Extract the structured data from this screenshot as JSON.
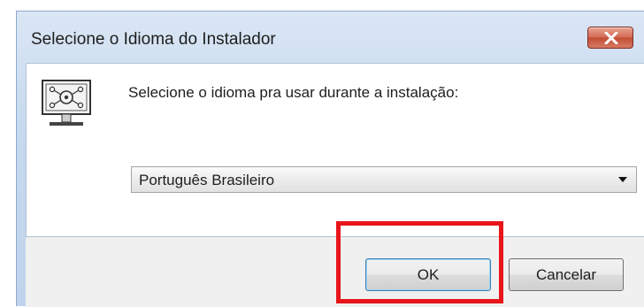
{
  "window": {
    "title": "Selecione o Idioma do Instalador"
  },
  "content": {
    "prompt": "Selecione o idioma pra usar durante a instalação:",
    "language_select": {
      "selected": "Português Brasileiro"
    }
  },
  "footer": {
    "ok_label": "OK",
    "cancel_label": "Cancelar"
  },
  "icons": {
    "app": "installer-monitor-icon",
    "close": "close-icon",
    "dropdown": "chevron-down-icon"
  },
  "colors": {
    "highlight": "#e8151a",
    "close_button": "#c9563f",
    "titlebar": "#c6d9ef"
  }
}
